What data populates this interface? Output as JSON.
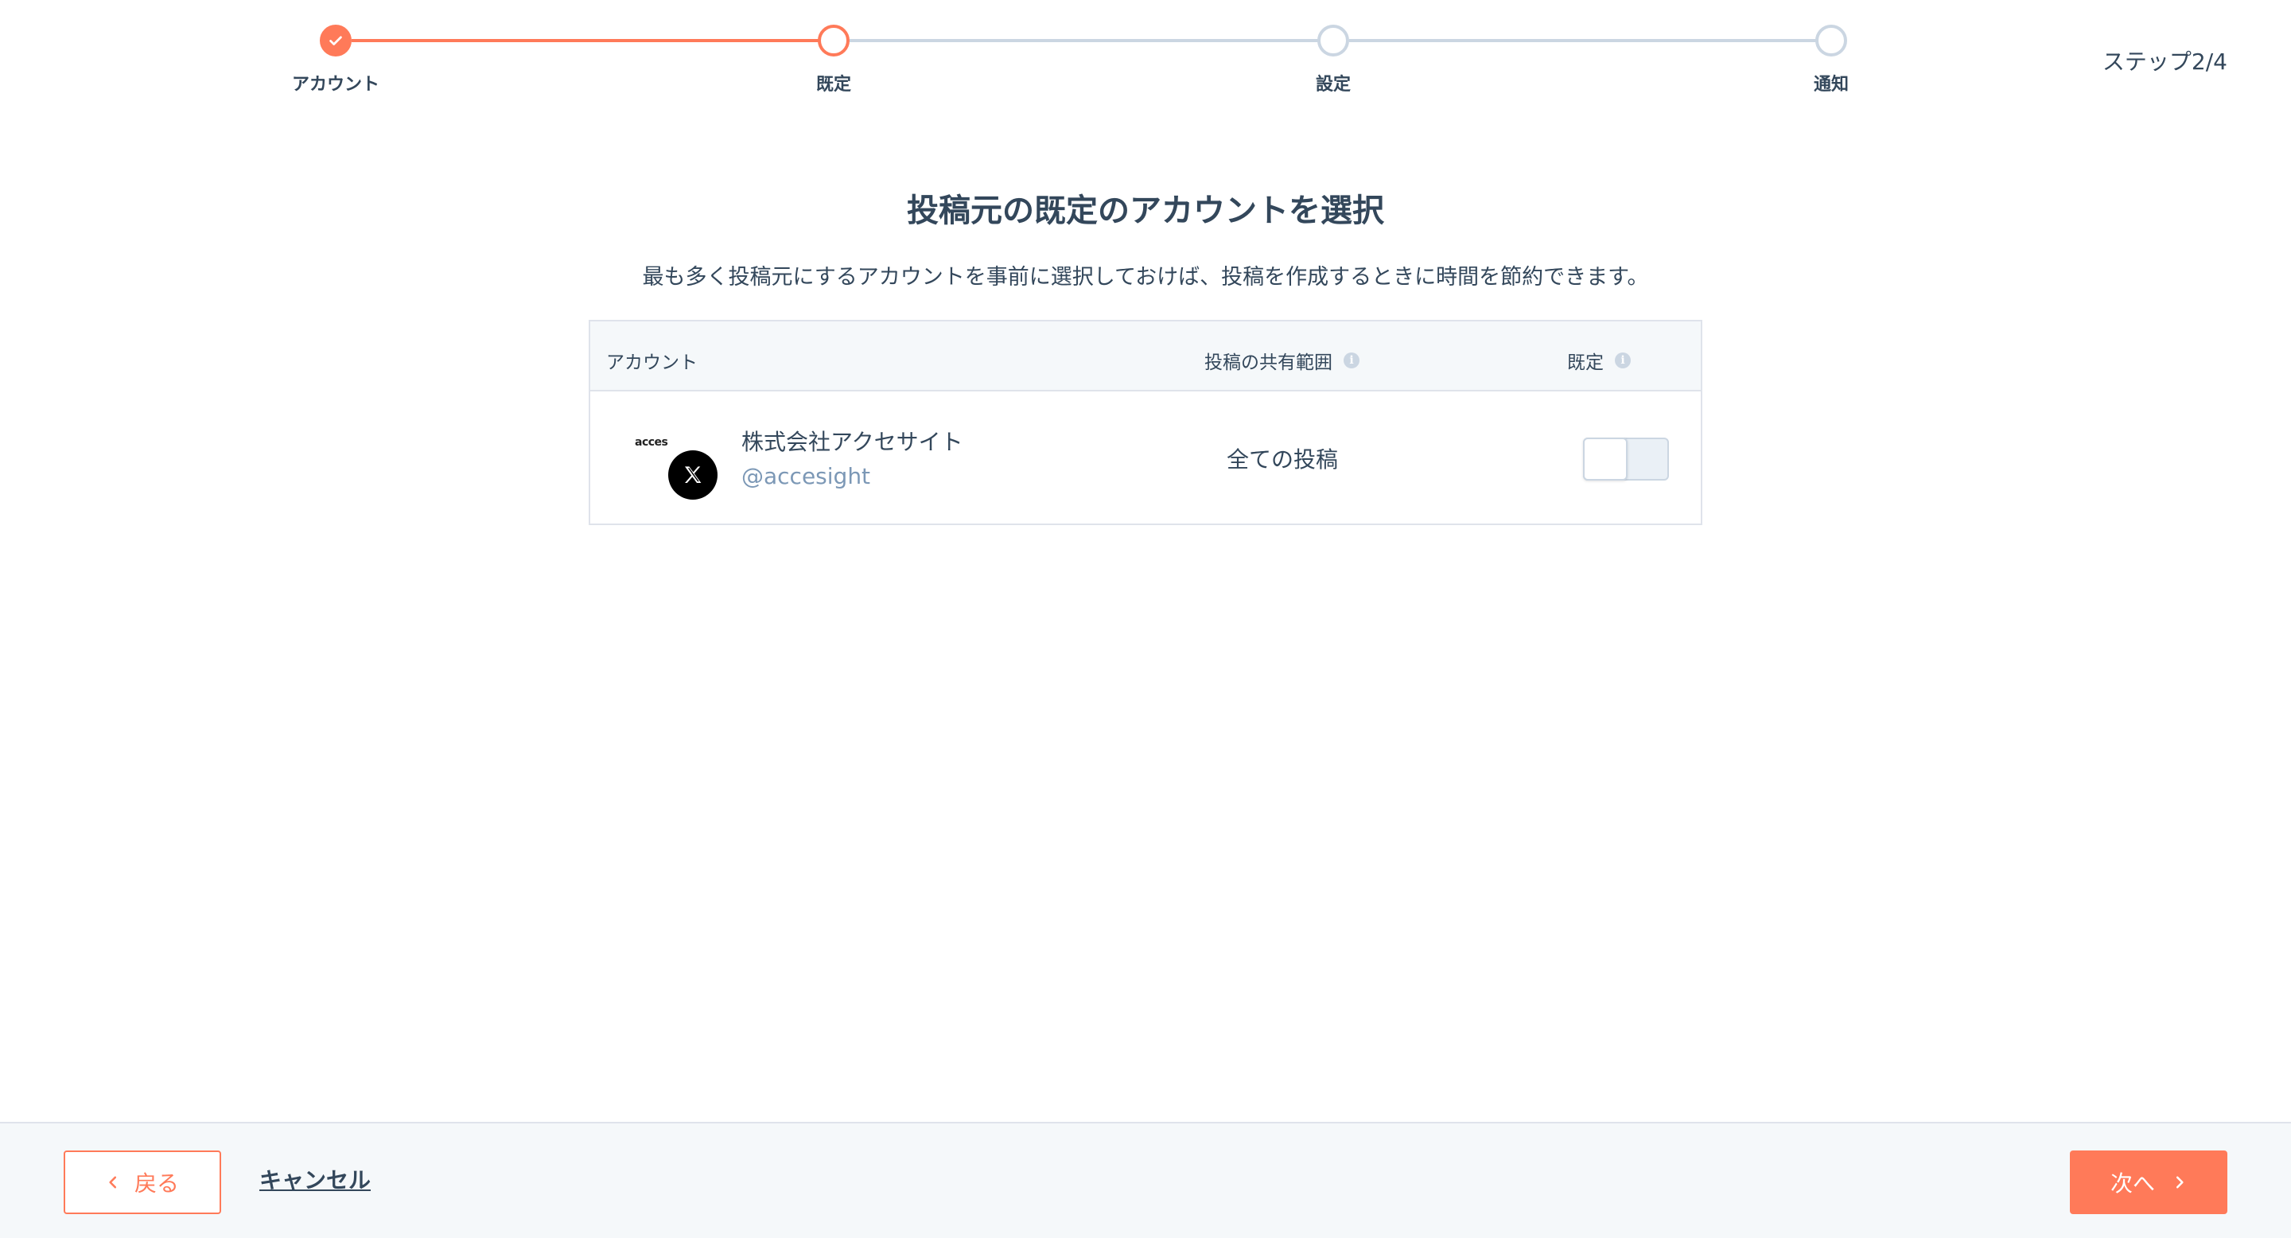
{
  "stepper": {
    "steps": [
      {
        "label": "アカウント",
        "state": "complete"
      },
      {
        "label": "既定",
        "state": "current"
      },
      {
        "label": "設定",
        "state": "upcoming"
      },
      {
        "label": "通知",
        "state": "upcoming"
      }
    ],
    "counter": "ステップ2/4"
  },
  "main": {
    "title": "投稿元の既定のアカウントを選択",
    "subtitle": "最も多く投稿元にするアカウントを事前に選択しておけば、投稿を作成するときに時間を節約できます。"
  },
  "table": {
    "headers": {
      "account": "アカウント",
      "scope": "投稿の共有範囲",
      "default": "既定",
      "info_icon": "info-icon"
    },
    "rows": [
      {
        "logo_text": "acces",
        "network_icon": "x-icon",
        "name": "株式会社アクセサイト",
        "handle": "@accesight",
        "scope": "全ての投稿",
        "default_on": false
      }
    ]
  },
  "footer": {
    "back_label": "戻る",
    "cancel_label": "キャンセル",
    "next_label": "次へ"
  },
  "colors": {
    "accent": "#ff7a59",
    "text": "#33475b",
    "muted": "#7c98b6",
    "border": "#dfe3eb",
    "inactive": "#cbd6e2"
  }
}
